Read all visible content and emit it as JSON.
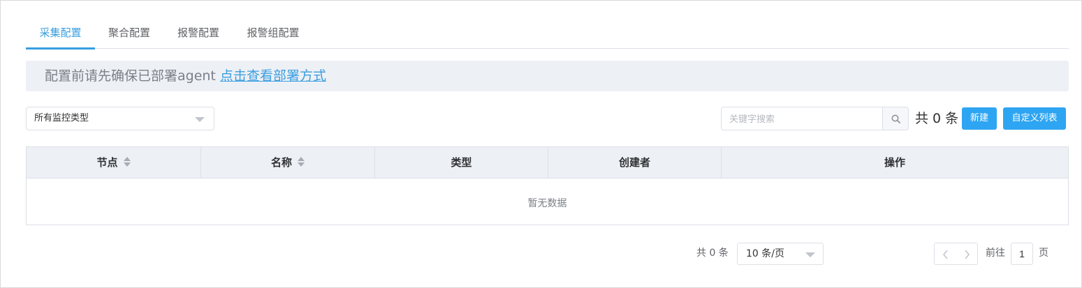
{
  "tabs": [
    {
      "label": "采集配置",
      "active": true
    },
    {
      "label": "聚合配置",
      "active": false
    },
    {
      "label": "报警配置",
      "active": false
    },
    {
      "label": "报警组配置",
      "active": false
    }
  ],
  "banner": {
    "text": "配置前请先确保已部署agent ",
    "link": "点击查看部署方式"
  },
  "filter": {
    "type_select_value": "所有监控类型",
    "search_placeholder": "关键字搜索",
    "total_text": "共 0 条",
    "new_button": "新建",
    "custom_columns_button": "自定义列表"
  },
  "table": {
    "columns": [
      {
        "label": "节点",
        "sortable": true
      },
      {
        "label": "名称",
        "sortable": true
      },
      {
        "label": "类型",
        "sortable": false
      },
      {
        "label": "创建者",
        "sortable": false
      },
      {
        "label": "操作",
        "sortable": false
      }
    ],
    "rows": [],
    "empty_text": "暂无数据"
  },
  "pagination": {
    "total_text": "共 0 条",
    "page_size": "10 条/页",
    "goto_label": "前往",
    "current_page": "1",
    "page_unit": "页"
  },
  "colors": {
    "accent": "#3a9ee0",
    "button": "#2ea5f2",
    "header_bg": "#edf0f5"
  },
  "icons": [
    "search-icon",
    "sort-icon",
    "chevron-down-icon",
    "chevron-left-icon",
    "chevron-right-icon"
  ]
}
